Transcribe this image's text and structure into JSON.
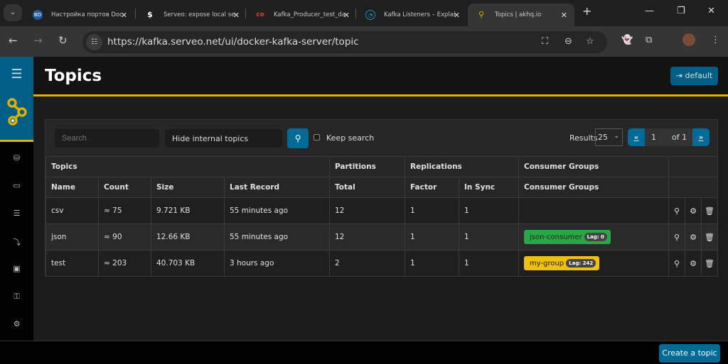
{
  "browser": {
    "tabs": [
      {
        "title": "Настройка портов Docker",
        "icon": "bd-icon"
      },
      {
        "title": "Serveo: expose local servers",
        "icon": "dollar-icon"
      },
      {
        "title": "Kafka_Producer_test_data",
        "icon": "colab-icon"
      },
      {
        "title": "Kafka Listeners – Explained",
        "icon": "site-icon"
      },
      {
        "title": "Topics | akhq.io",
        "icon": "akhq-icon",
        "active": true
      }
    ],
    "url": "https://kafka.serveo.net/ui/docker-kafka-server/topic"
  },
  "page": {
    "title": "Topics",
    "cluster_button": "default",
    "search_placeholder": "Search",
    "filter_value": "Hide internal topics",
    "keep_search_label": "Keep search",
    "keep_search_checked": false,
    "results_label": "Results",
    "results_per_page": "25",
    "page_prev": "«",
    "page_current": "1",
    "page_of": "of 1",
    "page_next": "»",
    "create_button": "Create a topic"
  },
  "table": {
    "group_headers": [
      "Topics",
      "Partitions",
      "Replications",
      "Consumer Groups"
    ],
    "headers": [
      "Name",
      "Count",
      "Size",
      "Last Record",
      "Total",
      "Factor",
      "In Sync",
      "Consumer Groups"
    ],
    "rows": [
      {
        "name": "csv",
        "count": "≈ 75",
        "size": "9.721 KB",
        "last_record": "55 minutes ago",
        "total": "12",
        "factor": "1",
        "in_sync": "1",
        "groups": []
      },
      {
        "name": "json",
        "count": "≈ 90",
        "size": "12.66 KB",
        "last_record": "55 minutes ago",
        "total": "12",
        "factor": "1",
        "in_sync": "1",
        "groups": [
          {
            "name": "json-consumer",
            "lag": "Lag: 0",
            "color": "#28a745"
          }
        ]
      },
      {
        "name": "test",
        "count": "≈ 203",
        "size": "40.703 KB",
        "last_record": "3 hours ago",
        "total": "2",
        "factor": "1",
        "in_sync": "1",
        "groups": [
          {
            "name": "my-group",
            "lag": "Lag: 242",
            "color": "#f0c010"
          }
        ]
      }
    ]
  },
  "colors": {
    "accent": "#005f87",
    "highlight": "#e0b000"
  }
}
